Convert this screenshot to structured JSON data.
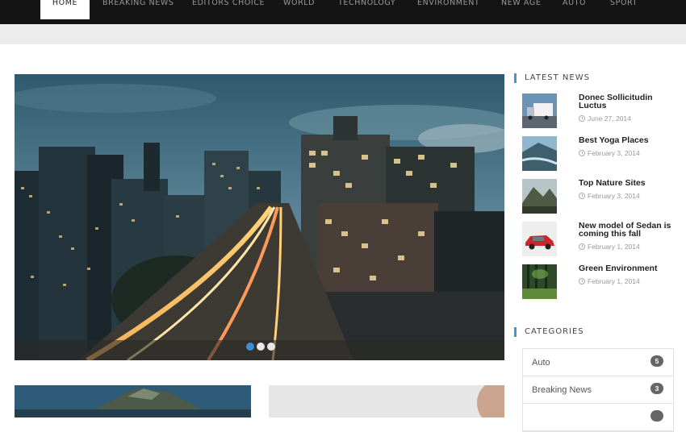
{
  "nav": {
    "items": [
      "HOME",
      "BREAKING NEWS",
      "EDITORS CHOICE",
      "WORLD",
      "TECHNOLOGY",
      "ENVIRONMENT",
      "NEW AGE",
      "AUTO",
      "SPORT"
    ],
    "active_index": 0
  },
  "slider": {
    "slide_count": 3,
    "active_slide": 0
  },
  "sidebar": {
    "latest_news_title": "LATEST NEWS",
    "news": [
      {
        "title": "Donec Sollicitudin Luctus",
        "date": "June 27, 2014",
        "thumb": "truck-image"
      },
      {
        "title": "Best Yoga Places",
        "date": "February 3, 2014",
        "thumb": "lake-image"
      },
      {
        "title": "Top Nature Sites",
        "date": "February 3, 2014",
        "thumb": "mountain-image"
      },
      {
        "title": "New model of Sedan is coming this fall",
        "date": "February 1, 2014",
        "thumb": "red-car-image"
      },
      {
        "title": "Green Environment",
        "date": "February 1, 2014",
        "thumb": "forest-image"
      }
    ],
    "categories_title": "CATEGORIES",
    "categories": [
      {
        "label": "Auto",
        "count": "5"
      },
      {
        "label": "Breaking News",
        "count": "3"
      },
      {
        "label": "",
        "count": ""
      }
    ]
  },
  "colors": {
    "accent": "#3a9ad9",
    "nav_bg": "#141414",
    "badge_bg": "#666666"
  }
}
